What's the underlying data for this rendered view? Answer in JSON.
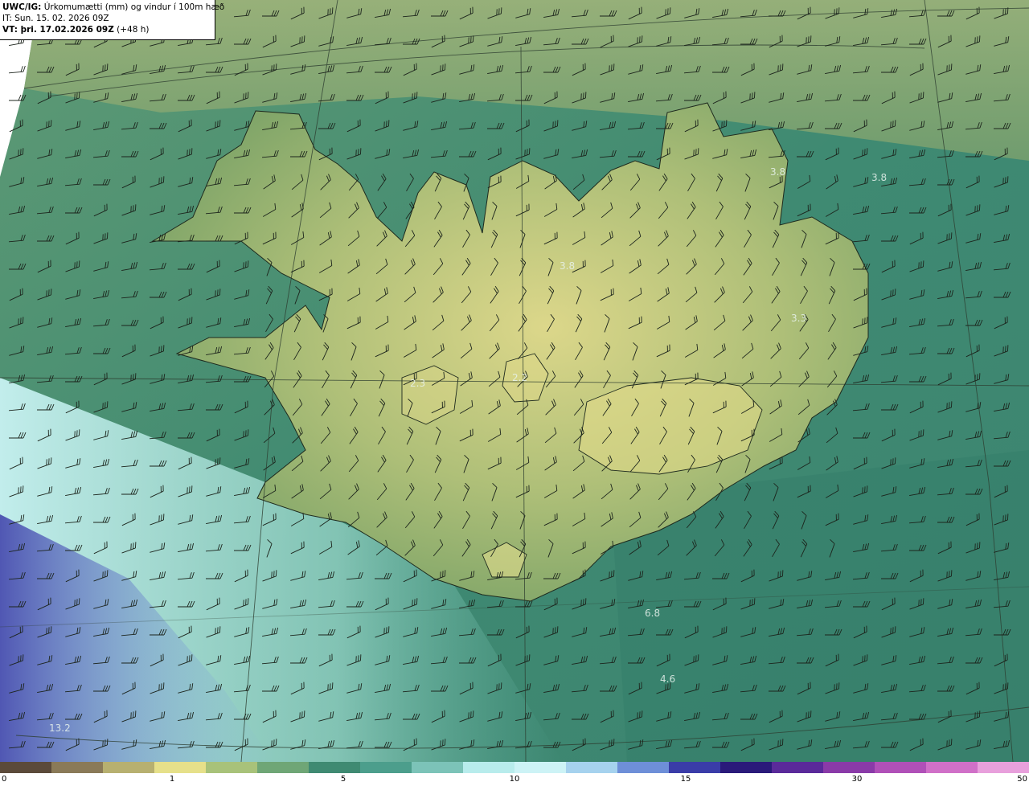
{
  "header": {
    "line1_label": "UWC/IG:",
    "line1_text": " Úrkomumætti (mm) og vindur í 100m hæð",
    "line2_label": "IT:",
    "line2_text": " Sun. 15. 02. 2026 09Z",
    "line3_label": "VT:",
    "line3_text": " þri. 17.02.2026 09Z",
    "line3_suffix": " (+48 h)"
  },
  "map_values": [
    {
      "text": "3.8"
    },
    {
      "text": "3.8"
    },
    {
      "text": "3.8"
    },
    {
      "text": "3.3"
    },
    {
      "text": "2.3"
    },
    {
      "text": "2.2"
    },
    {
      "text": "6.8"
    },
    {
      "text": "4.6"
    },
    {
      "text": "13.2"
    }
  ],
  "colorbar": {
    "ticks": [
      "0",
      "1",
      "5",
      "10",
      "15",
      "30",
      "50"
    ],
    "colors": [
      "#5b4a3a",
      "#8a7a58",
      "#b7b070",
      "#e6e08a",
      "#a8c27a",
      "#6fa676",
      "#3f8a72",
      "#4c9e8c",
      "#7cc3b8",
      "#b8ecec",
      "#cdf3f6",
      "#a6d2ee",
      "#6e8fd8",
      "#3a3ca8",
      "#2a1a7a",
      "#5a2a9a",
      "#8a3aa8",
      "#b050b8",
      "#d070c8",
      "#e8a0dc"
    ]
  },
  "legend_colors": {
    "land_high": "#e8e08c",
    "land_low": "#86a86a",
    "sea_teal": "#3f8c74",
    "sea_light": "#c6f2f2",
    "sea_blue": "#5a66c0"
  }
}
